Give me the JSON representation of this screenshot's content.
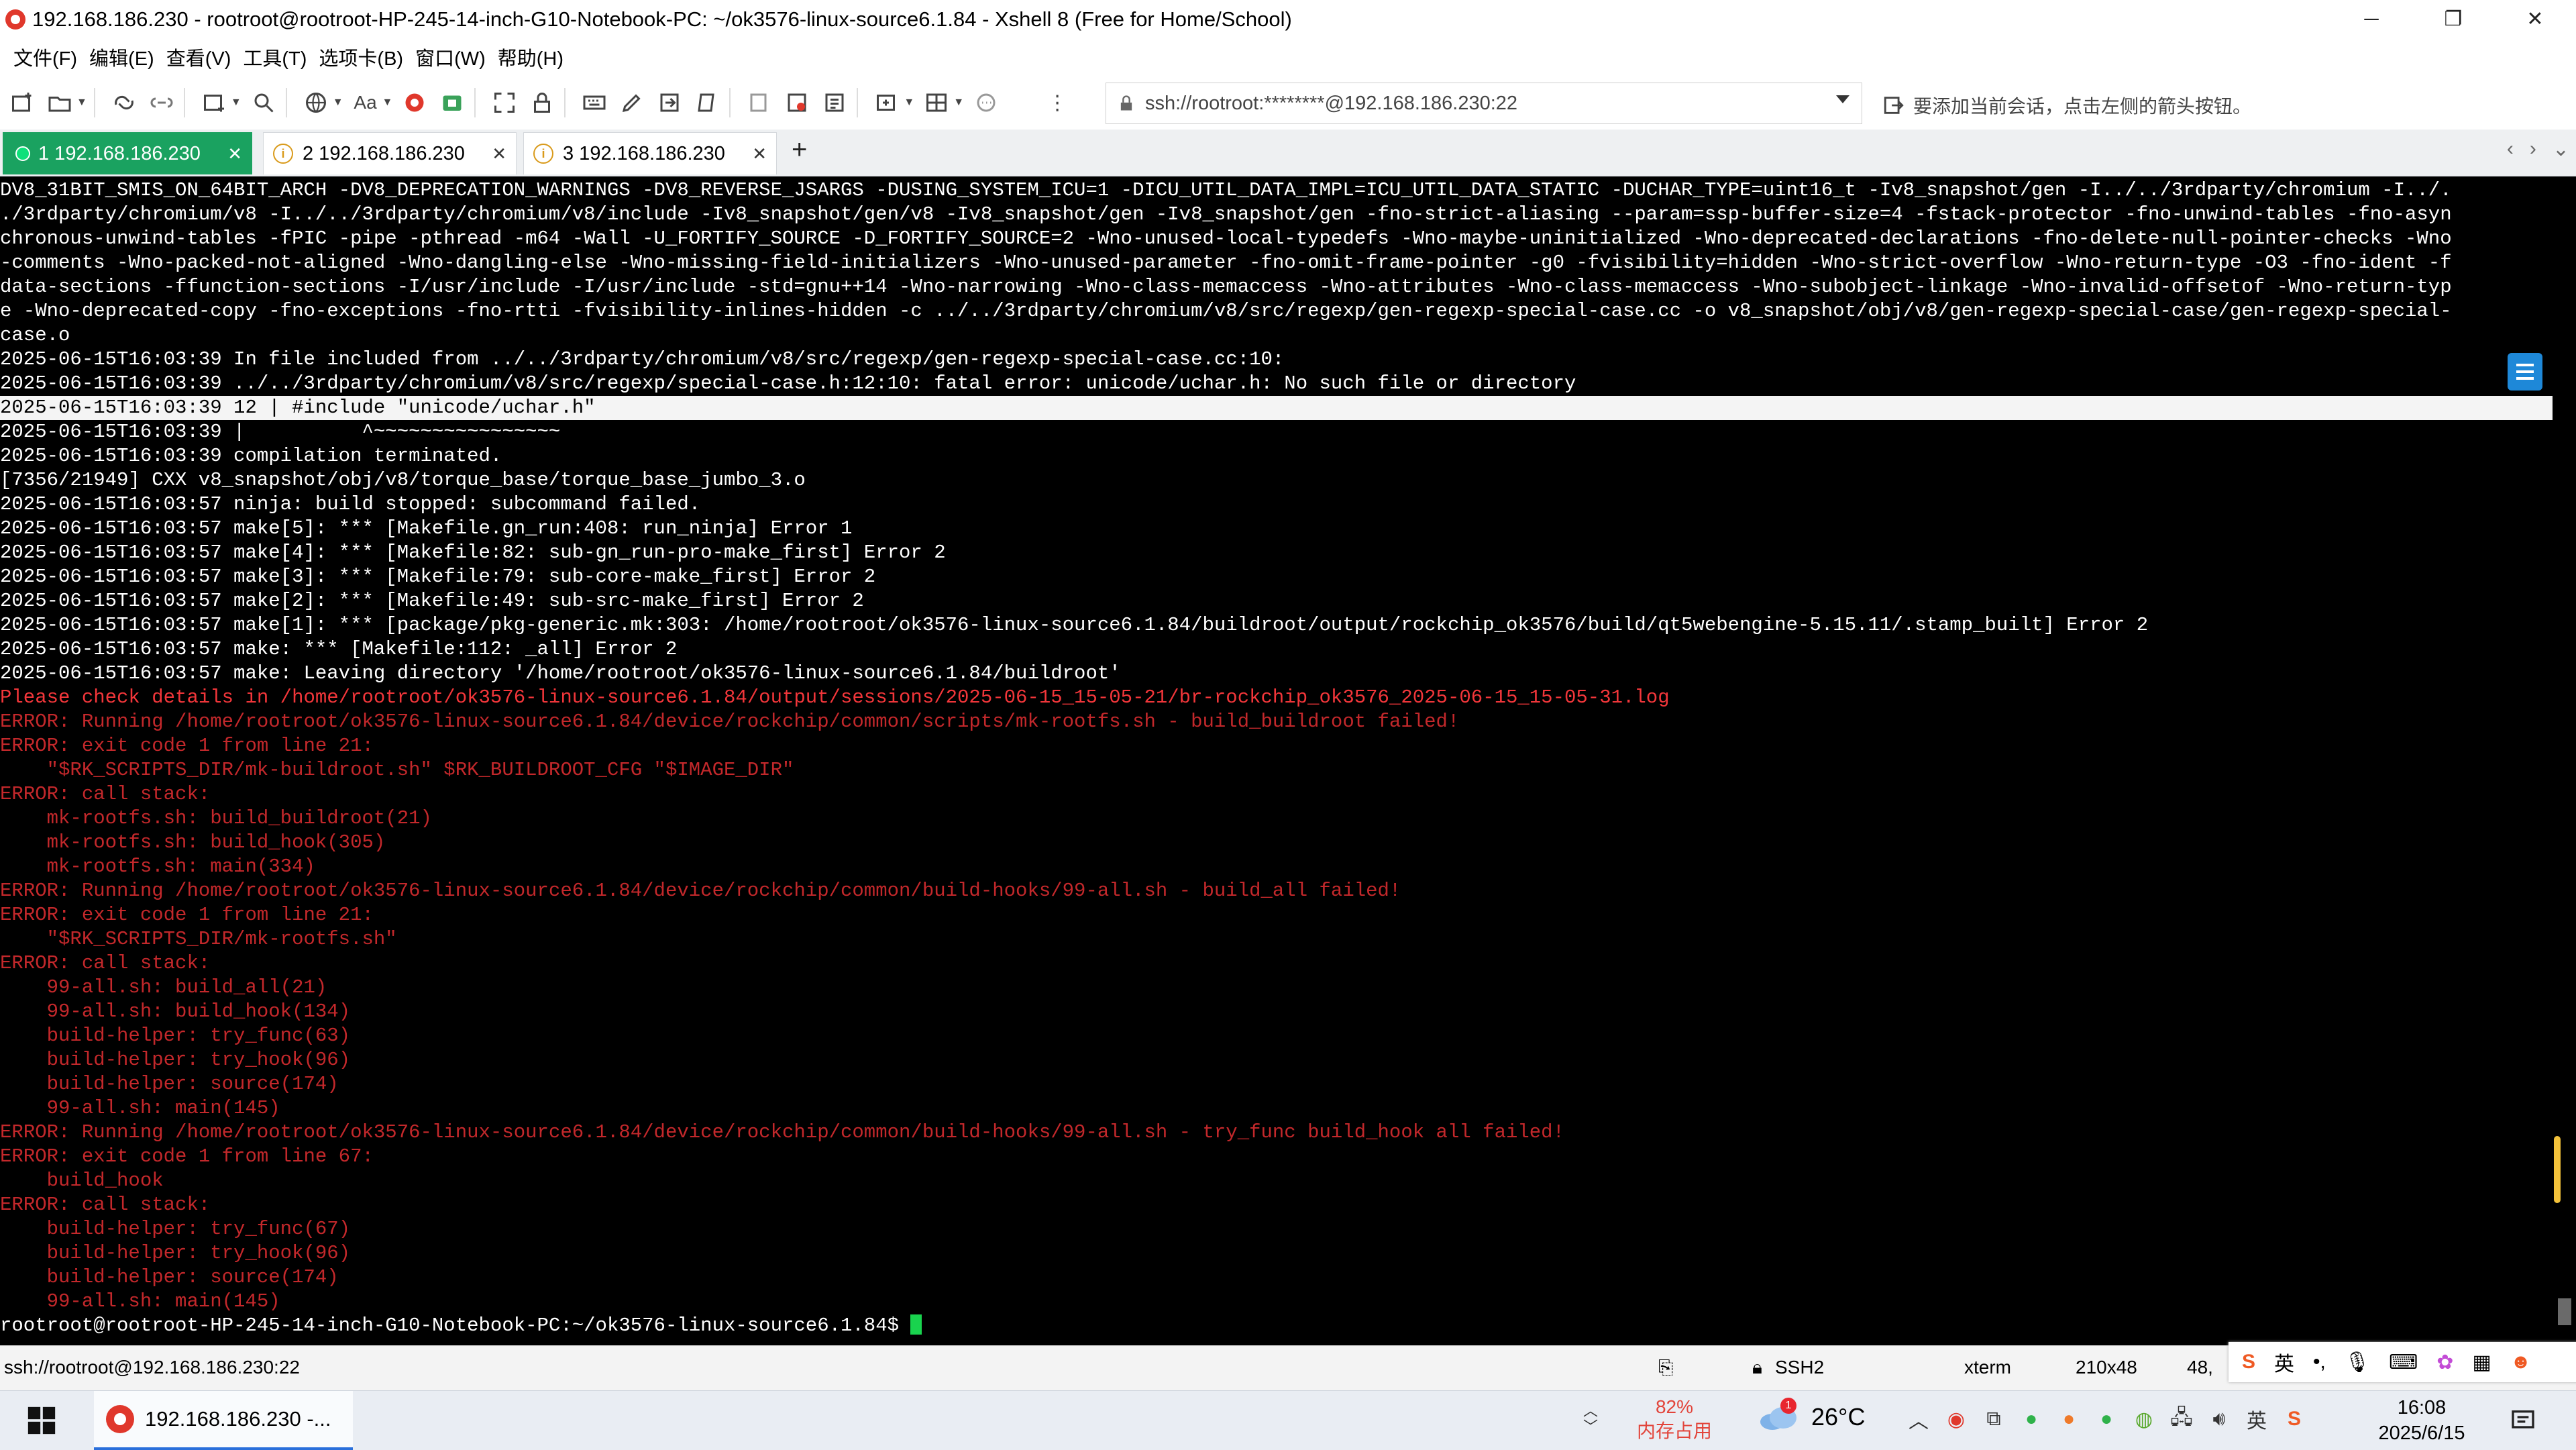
{
  "window": {
    "title": "192.168.186.230 - rootroot@rootroot-HP-245-14-inch-G10-Notebook-PC: ~/ok3576-linux-source6.1.84 - Xshell 8 (Free for Home/School)",
    "min": "─",
    "max": "❐",
    "close": "✕"
  },
  "menu": [
    "文件(F)",
    "编辑(E)",
    "查看(V)",
    "工具(T)",
    "选项卡(B)",
    "窗口(W)",
    "帮助(H)"
  ],
  "toolbar": {
    "address": "ssh://rootroot:********@192.168.186.230:22",
    "hint": "要添加当前会话，点击左侧的箭头按钮。",
    "font_label": "Aa"
  },
  "tabs": [
    {
      "label": "1 192.168.186.230",
      "active": true
    },
    {
      "label": "2 192.168.186.230",
      "active": false
    },
    {
      "label": "3 192.168.186.230",
      "active": false
    }
  ],
  "tab_add": "+",
  "tab_nav": [
    "‹",
    "›",
    "⌄"
  ],
  "terminal": {
    "lines": [
      {
        "t": "DV8_31BIT_SMIS_ON_64BIT_ARCH -DV8_DEPRECATION_WARNINGS -DV8_REVERSE_JSARGS -DUSING_SYSTEM_ICU=1 -DICU_UTIL_DATA_IMPL=ICU_UTIL_DATA_STATIC -DUCHAR_TYPE=uint16_t -Iv8_snapshot/gen -I../../3rdparty/chromium -I../.",
        "c": "w"
      },
      {
        "t": "./3rdparty/chromium/v8 -I../../3rdparty/chromium/v8/include -Iv8_snapshot/gen/v8 -Iv8_snapshot/gen -Iv8_snapshot/gen -fno-strict-aliasing --param=ssp-buffer-size=4 -fstack-protector -fno-unwind-tables -fno-asyn",
        "c": "w"
      },
      {
        "t": "chronous-unwind-tables -fPIC -pipe -pthread -m64 -Wall -U_FORTIFY_SOURCE -D_FORTIFY_SOURCE=2 -Wno-unused-local-typedefs -Wno-maybe-uninitialized -Wno-deprecated-declarations -fno-delete-null-pointer-checks -Wno",
        "c": "w"
      },
      {
        "t": "-comments -Wno-packed-not-aligned -Wno-dangling-else -Wno-missing-field-initializers -Wno-unused-parameter -fno-omit-frame-pointer -g0 -fvisibility=hidden -Wno-strict-overflow -Wno-return-type -O3 -fno-ident -f",
        "c": "w"
      },
      {
        "t": "data-sections -ffunction-sections -I/usr/include -I/usr/include -std=gnu++14 -Wno-narrowing -Wno-class-memaccess -Wno-attributes -Wno-class-memaccess -Wno-subobject-linkage -Wno-invalid-offsetof -Wno-return-typ",
        "c": "w"
      },
      {
        "t": "e -Wno-deprecated-copy -fno-exceptions -fno-rtti -fvisibility-inlines-hidden -c ../../3rdparty/chromium/v8/src/regexp/gen-regexp-special-case.cc -o v8_snapshot/obj/v8/gen-regexp-special-case/gen-regexp-special-",
        "c": "w"
      },
      {
        "t": "case.o",
        "c": "w"
      },
      {
        "t": "2025-06-15T16:03:39 In file included from ../../3rdparty/chromium/v8/src/regexp/gen-regexp-special-case.cc:10:",
        "c": "w"
      },
      {
        "t": "2025-06-15T16:03:39 ../../3rdparty/chromium/v8/src/regexp/special-case.h:12:10: fatal error: unicode/uchar.h: No such file or directory",
        "c": "w"
      },
      {
        "t": "2025-06-15T16:03:39 12 | #include \"unicode/uchar.h\"",
        "c": "hl"
      },
      {
        "t": "2025-06-15T16:03:39 |          ^~~~~~~~~~~~~~~~~",
        "c": "w"
      },
      {
        "t": "2025-06-15T16:03:39 compilation terminated.",
        "c": "w"
      },
      {
        "t": "[7356/21949] CXX v8_snapshot/obj/v8/torque_base/torque_base_jumbo_3.o",
        "c": "w"
      },
      {
        "t": "2025-06-15T16:03:57 ninja: build stopped: subcommand failed.",
        "c": "w"
      },
      {
        "t": "2025-06-15T16:03:57 make[5]: *** [Makefile.gn_run:408: run_ninja] Error 1",
        "c": "w"
      },
      {
        "t": "2025-06-15T16:03:57 make[4]: *** [Makefile:82: sub-gn_run-pro-make_first] Error 2",
        "c": "w"
      },
      {
        "t": "2025-06-15T16:03:57 make[3]: *** [Makefile:79: sub-core-make_first] Error 2",
        "c": "w"
      },
      {
        "t": "2025-06-15T16:03:57 make[2]: *** [Makefile:49: sub-src-make_first] Error 2",
        "c": "w"
      },
      {
        "t": "2025-06-15T16:03:57 make[1]: *** [package/pkg-generic.mk:303: /home/rootroot/ok3576-linux-source6.1.84/buildroot/output/rockchip_ok3576/build/qt5webengine-5.15.11/.stamp_built] Error 2",
        "c": "w"
      },
      {
        "t": "2025-06-15T16:03:57 make: *** [Makefile:112: _all] Error 2",
        "c": "w"
      },
      {
        "t": "2025-06-15T16:03:57 make: Leaving directory '/home/rootroot/ok3576-linux-source6.1.84/buildroot'",
        "c": "w"
      },
      {
        "t": "Please check details in /home/rootroot/ok3576-linux-source6.1.84/output/sessions/2025-06-15_15-05-21/br-rockchip_ok3576_2025-06-15_15-05-31.log",
        "c": "r"
      },
      {
        "t": "ERROR: Running /home/rootroot/ok3576-linux-source6.1.84/device/rockchip/common/scripts/mk-rootfs.sh - build_buildroot failed!",
        "c": "rd"
      },
      {
        "t": "ERROR: exit code 1 from line 21:",
        "c": "rd"
      },
      {
        "t": "    \"$RK_SCRIPTS_DIR/mk-buildroot.sh\" $RK_BUILDROOT_CFG \"$IMAGE_DIR\"",
        "c": "rd"
      },
      {
        "t": "ERROR: call stack:",
        "c": "rd"
      },
      {
        "t": "    mk-rootfs.sh: build_buildroot(21)",
        "c": "rd"
      },
      {
        "t": "    mk-rootfs.sh: build_hook(305)",
        "c": "rd"
      },
      {
        "t": "    mk-rootfs.sh: main(334)",
        "c": "rd"
      },
      {
        "t": "ERROR: Running /home/rootroot/ok3576-linux-source6.1.84/device/rockchip/common/build-hooks/99-all.sh - build_all failed!",
        "c": "rd"
      },
      {
        "t": "ERROR: exit code 1 from line 21:",
        "c": "rd"
      },
      {
        "t": "    \"$RK_SCRIPTS_DIR/mk-rootfs.sh\"",
        "c": "rd"
      },
      {
        "t": "ERROR: call stack:",
        "c": "rd"
      },
      {
        "t": "    99-all.sh: build_all(21)",
        "c": "rd"
      },
      {
        "t": "    99-all.sh: build_hook(134)",
        "c": "rd"
      },
      {
        "t": "    build-helper: try_func(63)",
        "c": "rd"
      },
      {
        "t": "    build-helper: try_hook(96)",
        "c": "rd"
      },
      {
        "t": "    build-helper: source(174)",
        "c": "rd"
      },
      {
        "t": "    99-all.sh: main(145)",
        "c": "rd"
      },
      {
        "t": "ERROR: Running /home/rootroot/ok3576-linux-source6.1.84/device/rockchip/common/build-hooks/99-all.sh - try_func build_hook all failed!",
        "c": "rd"
      },
      {
        "t": "ERROR: exit code 1 from line 67:",
        "c": "rd"
      },
      {
        "t": "    build_hook",
        "c": "rd"
      },
      {
        "t": "ERROR: call stack:",
        "c": "rd"
      },
      {
        "t": "    build-helper: try_func(67)",
        "c": "rd"
      },
      {
        "t": "    build-helper: try_hook(96)",
        "c": "rd"
      },
      {
        "t": "    build-helper: source(174)",
        "c": "rd"
      },
      {
        "t": "    99-all.sh: main(145)",
        "c": "rd"
      }
    ],
    "prompt": "rootroot@rootroot-HP-245-14-inch-G10-Notebook-PC:~/ok3576-linux-source6.1.84$ "
  },
  "statusbar": {
    "connection": "ssh://rootroot@192.168.186.230:22",
    "protocol": "SSH2",
    "term": "xterm",
    "size": "210x48",
    "pos": "48,"
  },
  "ime": {
    "lang": "英"
  },
  "taskbar": {
    "app_label": "192.168.186.230 -...",
    "mem_value": "82%",
    "mem_label": "内存占用",
    "temperature": "26°C",
    "weather_badge": "1",
    "time": "16:08",
    "date": "2025/6/15"
  },
  "colors": {
    "tab_active": "#1aa260",
    "error_red": "#c3282b",
    "accent_blue": "#1e88d8"
  }
}
